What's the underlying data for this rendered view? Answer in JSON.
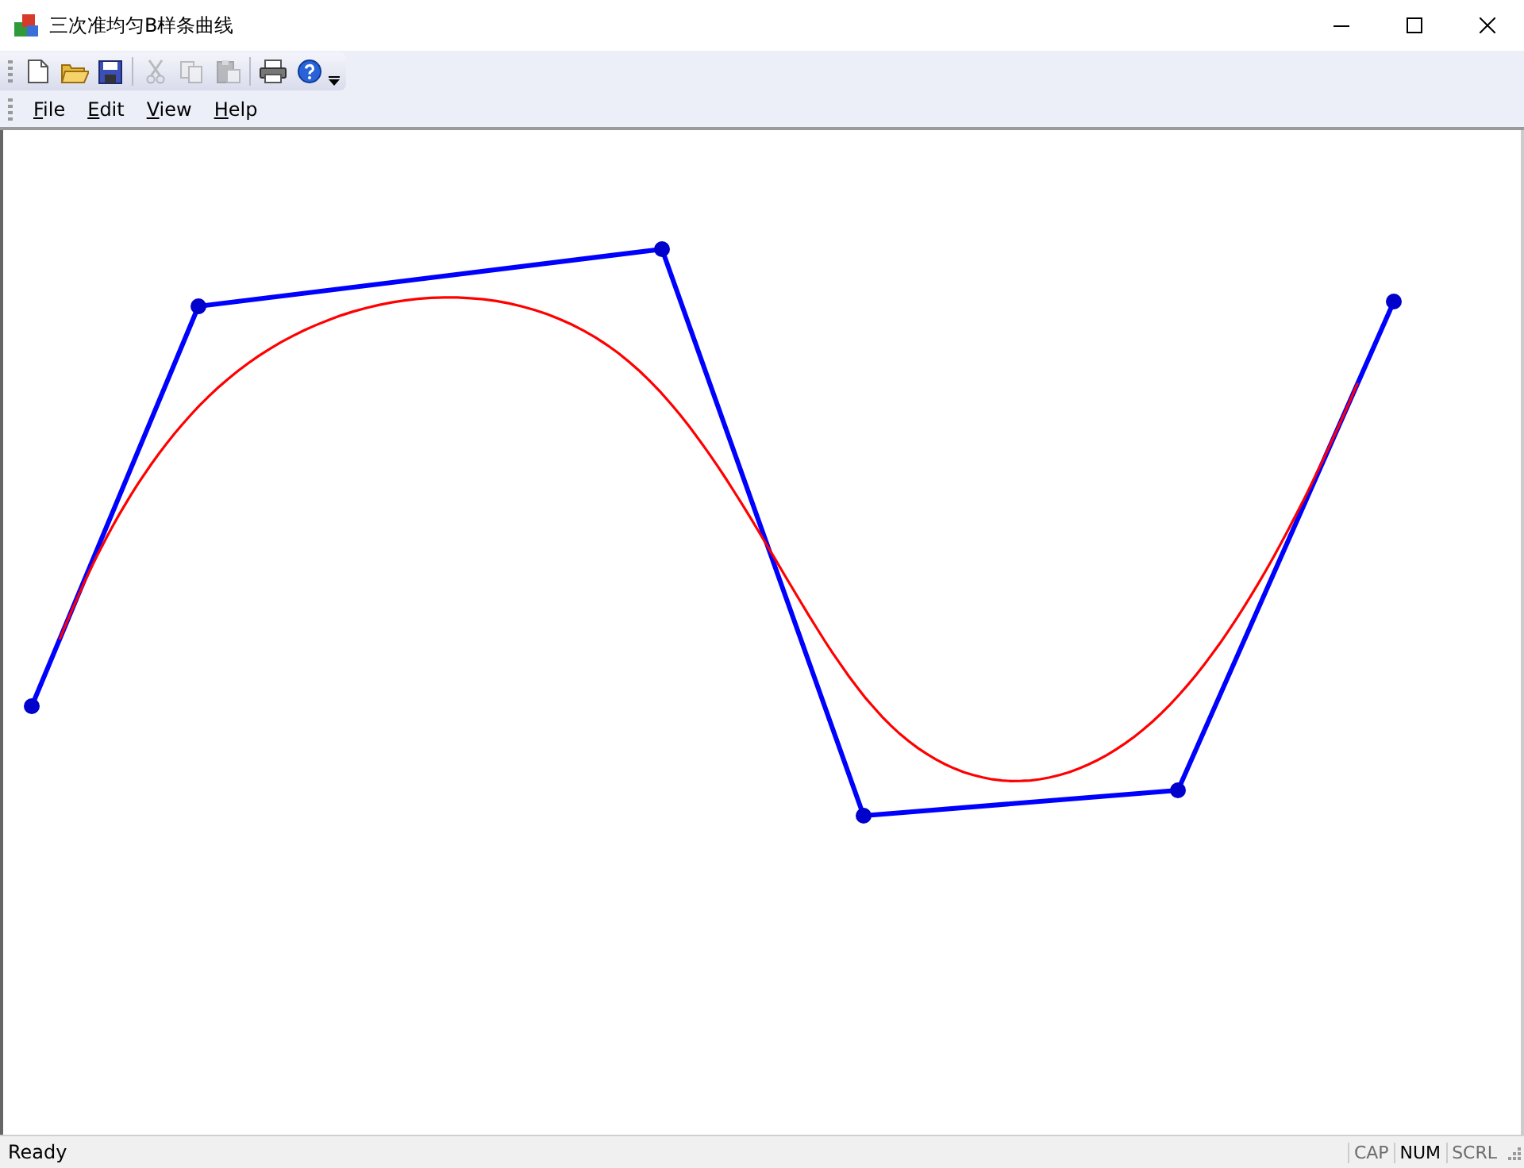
{
  "window": {
    "title": "三次准均匀B样条曲线"
  },
  "toolbar": [
    {
      "kind": "new",
      "disabled": false
    },
    {
      "kind": "open",
      "disabled": false
    },
    {
      "kind": "save",
      "disabled": false
    },
    {
      "kind": "cut",
      "disabled": true
    },
    {
      "kind": "copy",
      "disabled": true
    },
    {
      "kind": "paste",
      "disabled": true
    },
    {
      "kind": "print",
      "disabled": false
    },
    {
      "kind": "help",
      "disabled": false
    }
  ],
  "menu": [
    "File",
    "Edit",
    "View",
    "Help"
  ],
  "status_bar": {
    "text": "Ready",
    "indicators": [
      {
        "label": "CAP",
        "on": false
      },
      {
        "label": "NUM",
        "on": true
      },
      {
        "label": "SCRL",
        "on": false
      }
    ]
  }
}
